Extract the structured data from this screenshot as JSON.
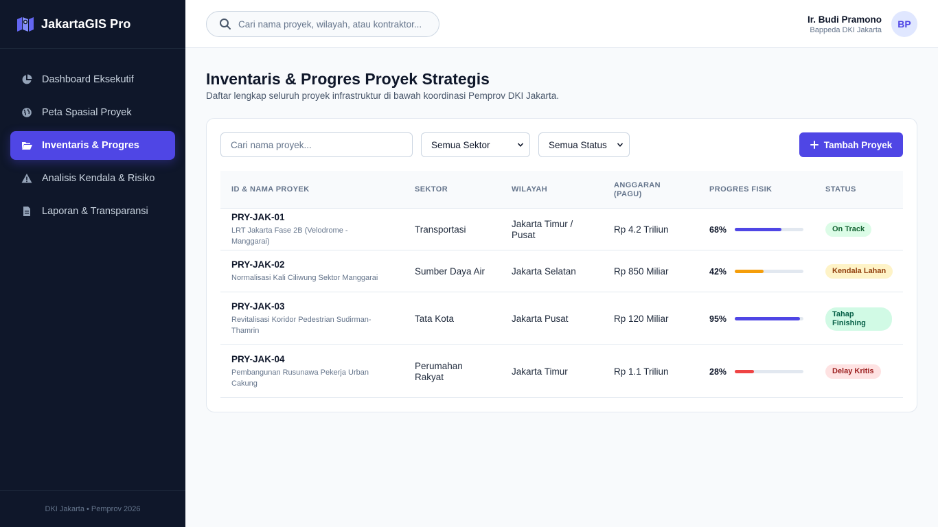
{
  "app": {
    "name": "JakartaGIS Pro"
  },
  "sidebar": {
    "items": [
      {
        "label": "Dashboard Eksekutif",
        "icon": "chart-pie-icon",
        "active": false
      },
      {
        "label": "Peta Spasial Proyek",
        "icon": "globe-icon",
        "active": false
      },
      {
        "label": "Inventaris & Progres",
        "icon": "folder-open-icon",
        "active": true
      },
      {
        "label": "Analisis Kendala & Risiko",
        "icon": "warning-triangle-icon",
        "active": false
      },
      {
        "label": "Laporan & Transparansi",
        "icon": "file-icon",
        "active": false
      }
    ],
    "footer": "DKI Jakarta • Pemprov 2026"
  },
  "topbar": {
    "search_placeholder": "Cari nama proyek, wilayah, atau kontraktor...",
    "user": {
      "name": "Ir. Budi Pramono",
      "role": "Bappeda DKI Jakarta",
      "initials": "BP"
    }
  },
  "page": {
    "title": "Inventaris & Progres Proyek Strategis",
    "subtitle": "Daftar lengkap seluruh proyek infrastruktur di bawah koordinasi Pemprov DKI Jakarta."
  },
  "filters": {
    "search_placeholder": "Cari nama proyek...",
    "sector_selected": "Semua Sektor",
    "status_selected": "Semua Status",
    "add_button": "Tambah Proyek"
  },
  "table": {
    "columns": [
      "ID & Nama Proyek",
      "Sektor",
      "Wilayah",
      "Anggaran (Pagu)",
      "Progres Fisik",
      "Status"
    ],
    "rows": [
      {
        "id": "PRY-JAK-01",
        "name": "LRT Jakarta Fase 2B (Velodrome - Manggarai)",
        "sector": "Transportasi",
        "region": "Jakarta Timur / Pusat",
        "budget": "Rp 4.2 Triliun",
        "progress": 68,
        "progress_label": "68%",
        "progress_color": "#4f46e5",
        "status": "On Track",
        "status_bg": "#dcfce7",
        "status_fg": "#166534"
      },
      {
        "id": "PRY-JAK-02",
        "name": "Normalisasi Kali Ciliwung Sektor Manggarai",
        "sector": "Sumber Daya Air",
        "region": "Jakarta Selatan",
        "budget": "Rp 850 Miliar",
        "progress": 42,
        "progress_label": "42%",
        "progress_color": "#f59e0b",
        "status": "Kendala Lahan",
        "status_bg": "#fef3c7",
        "status_fg": "#92400e"
      },
      {
        "id": "PRY-JAK-03",
        "name": "Revitalisasi Koridor Pedestrian Sudirman-Thamrin",
        "sector": "Tata Kota",
        "region": "Jakarta Pusat",
        "budget": "Rp 120 Miliar",
        "progress": 95,
        "progress_label": "95%",
        "progress_color": "#4f46e5",
        "status": "Tahap Finishing",
        "status_bg": "#d1fae5",
        "status_fg": "#065f46"
      },
      {
        "id": "PRY-JAK-04",
        "name": "Pembangunan Rusunawa Pekerja Urban Cakung",
        "sector": "Perumahan Rakyat",
        "region": "Jakarta Timur",
        "budget": "Rp 1.1 Triliun",
        "progress": 28,
        "progress_label": "28%",
        "progress_color": "#ef4444",
        "status": "Delay Kritis",
        "status_bg": "#fee2e2",
        "status_fg": "#991b1b"
      }
    ]
  }
}
